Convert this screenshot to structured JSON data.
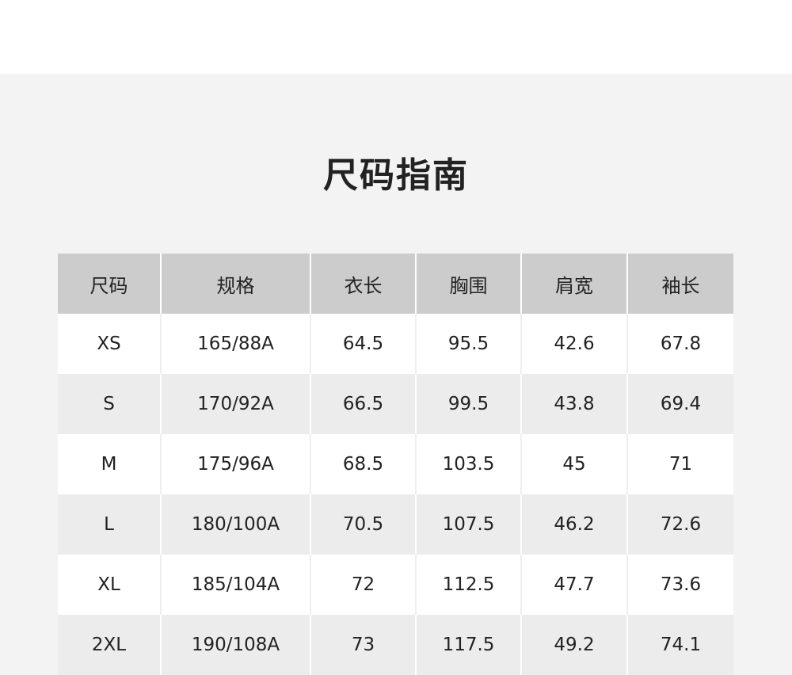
{
  "title": "尺码指南",
  "table": {
    "headers": [
      "尺码",
      "规格",
      "衣长",
      "胸围",
      "肩宽",
      "袖长"
    ],
    "rows": [
      [
        "XS",
        "165/88A",
        "64.5",
        "95.5",
        "42.6",
        "67.8"
      ],
      [
        "S",
        "170/92A",
        "66.5",
        "99.5",
        "43.8",
        "69.4"
      ],
      [
        "M",
        "175/96A",
        "68.5",
        "103.5",
        "45",
        "71"
      ],
      [
        "L",
        "180/100A",
        "70.5",
        "107.5",
        "46.2",
        "72.6"
      ],
      [
        "XL",
        "185/104A",
        "72",
        "112.5",
        "47.7",
        "73.6"
      ],
      [
        "2XL",
        "190/108A",
        "73",
        "117.5",
        "49.2",
        "74.1"
      ]
    ]
  },
  "colors": {
    "header_bg": "#cccccc",
    "panel_bg": "#f3f3f3",
    "row_alt_bg": "#ececec",
    "text": "#222222"
  }
}
